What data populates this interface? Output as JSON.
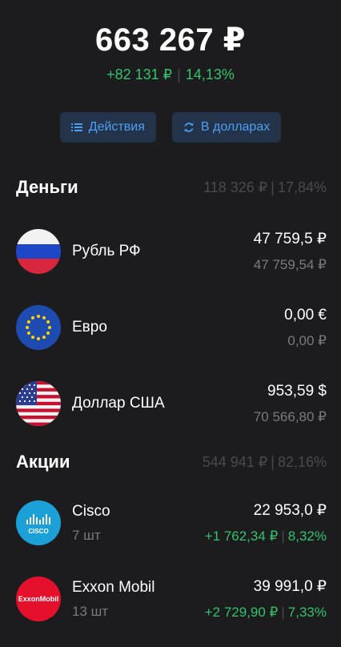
{
  "summary": {
    "total": "663 267 ₽",
    "change_abs": "+82 131 ₽",
    "change_pct": "14,13%",
    "separator": "|"
  },
  "actions": {
    "actions_label": "Действия",
    "currency_label": "В долларах"
  },
  "money": {
    "title": "Деньги",
    "sum": "118 326 ₽",
    "pct": "17,84%",
    "items": [
      {
        "name": "Рубль РФ",
        "value": "47 759,5 ₽",
        "value_rub": "47 759,54 ₽"
      },
      {
        "name": "Евро",
        "value": "0,00 €",
        "value_rub": "0,00 ₽"
      },
      {
        "name": "Доллар США",
        "value": "953,59 $",
        "value_rub": "70 566,80 ₽"
      }
    ]
  },
  "stocks": {
    "title": "Акции",
    "sum": "544 941 ₽",
    "pct": "82,16%",
    "items": [
      {
        "name": "Cisco",
        "qty": "7 шт",
        "value": "22 953,0 ₽",
        "gain_abs": "+1 762,34 ₽",
        "gain_pct": "8,32%",
        "logo_text": "CISCO"
      },
      {
        "name": "Exxon Mobil",
        "qty": "13 шт",
        "value": "39 991,0 ₽",
        "gain_abs": "+2 729,90 ₽",
        "gain_pct": "7,33%",
        "logo_text": "ExxonMobil"
      }
    ]
  },
  "colors": {
    "background": "#1c1c1e",
    "positive": "#33c26b",
    "accent": "#4d9ff5",
    "button_bg": "#23344a"
  },
  "icons": {
    "actions": "list-icon",
    "currency": "refresh-icon"
  }
}
